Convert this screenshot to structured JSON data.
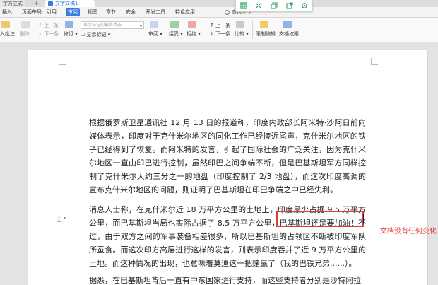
{
  "titlebar": {
    "doc_tab_partial": "字方立式",
    "active_tab": "文字文稿1"
  },
  "float_toolbar": {
    "icons": [
      "frame-icon",
      "expand-icon",
      "copy-icon",
      "export-icon",
      "settings-icon"
    ]
  },
  "menu": {
    "items": [
      "插入",
      "页面布局",
      "引用",
      "审阅",
      "视图",
      "章节",
      "安全",
      "开发工具",
      "特色应用"
    ],
    "active": "审阅",
    "search": "查找命令..."
  },
  "ribbon": {
    "insert_comment": "入批注",
    "delete": "删除",
    "prev_comment": "上一条",
    "next_comment": "下一条",
    "revise": "修订",
    "select_placeholder": "显示标记的最终状态",
    "show_markup": "显示标记",
    "review": "审阅",
    "accept": "接受",
    "reject": "拒绝",
    "prev": "上一条",
    "next": "下一条",
    "compare": "比较",
    "restrict_edit": "限制编辑",
    "doc_permission": "文档权限"
  },
  "document": {
    "para1": "根据俄罗斯卫星通讯社 12 月 13 日的报道称，印度内政部长阿米特·沙阿日前向媒体表示，印度对于克什米尔地区的同化工作已经接近尾声，克什米尔地区的铁子已经得到了恢复。而阿米特的发言，引起了国际社会的广泛关注，因为克什米尔地区一直由印巴进行控制，虽然印巴之间争端不断，但是巴基斯坦军方同样控制了克什米尔大约三分之一的地盘（印度控制了 2/3 地盘），而这次印度高调的宣布克什米尔地区的问题，则证明了巴基斯坦在印巴争端之中已经失利。",
    "para2_a": "消息人士称，在克什米尔近 18 万平方公里的土地上，印度最少占据 9.5 万平方公里，而巴基斯坦当局也实际占据了 8.5 万平方公里，",
    "para2_highlight": "巴基斯坦还是要加油！",
    "para2_b": "不过，由于双方之间的军事装备相差很多，所以巴基斯坦的占领区不断被印度军队所蚕食。而这次印方高层进行这样的发言，则表示印度吞并了近 9 万平方公里的土地。而这种情况的出现，也意味着莫迪这一把赌赢了（我的巴铁兄弟......）。",
    "para3": "据悉，在巴基斯坦背后一直有中东国家进行支持，而这些支持者分别是沙特阿拉"
  },
  "annotation": {
    "text": "文档没有任何变化",
    "color": "#e23b3b"
  },
  "colors": {
    "accent": "#3c7be0",
    "highlight": "#e23b3b"
  }
}
